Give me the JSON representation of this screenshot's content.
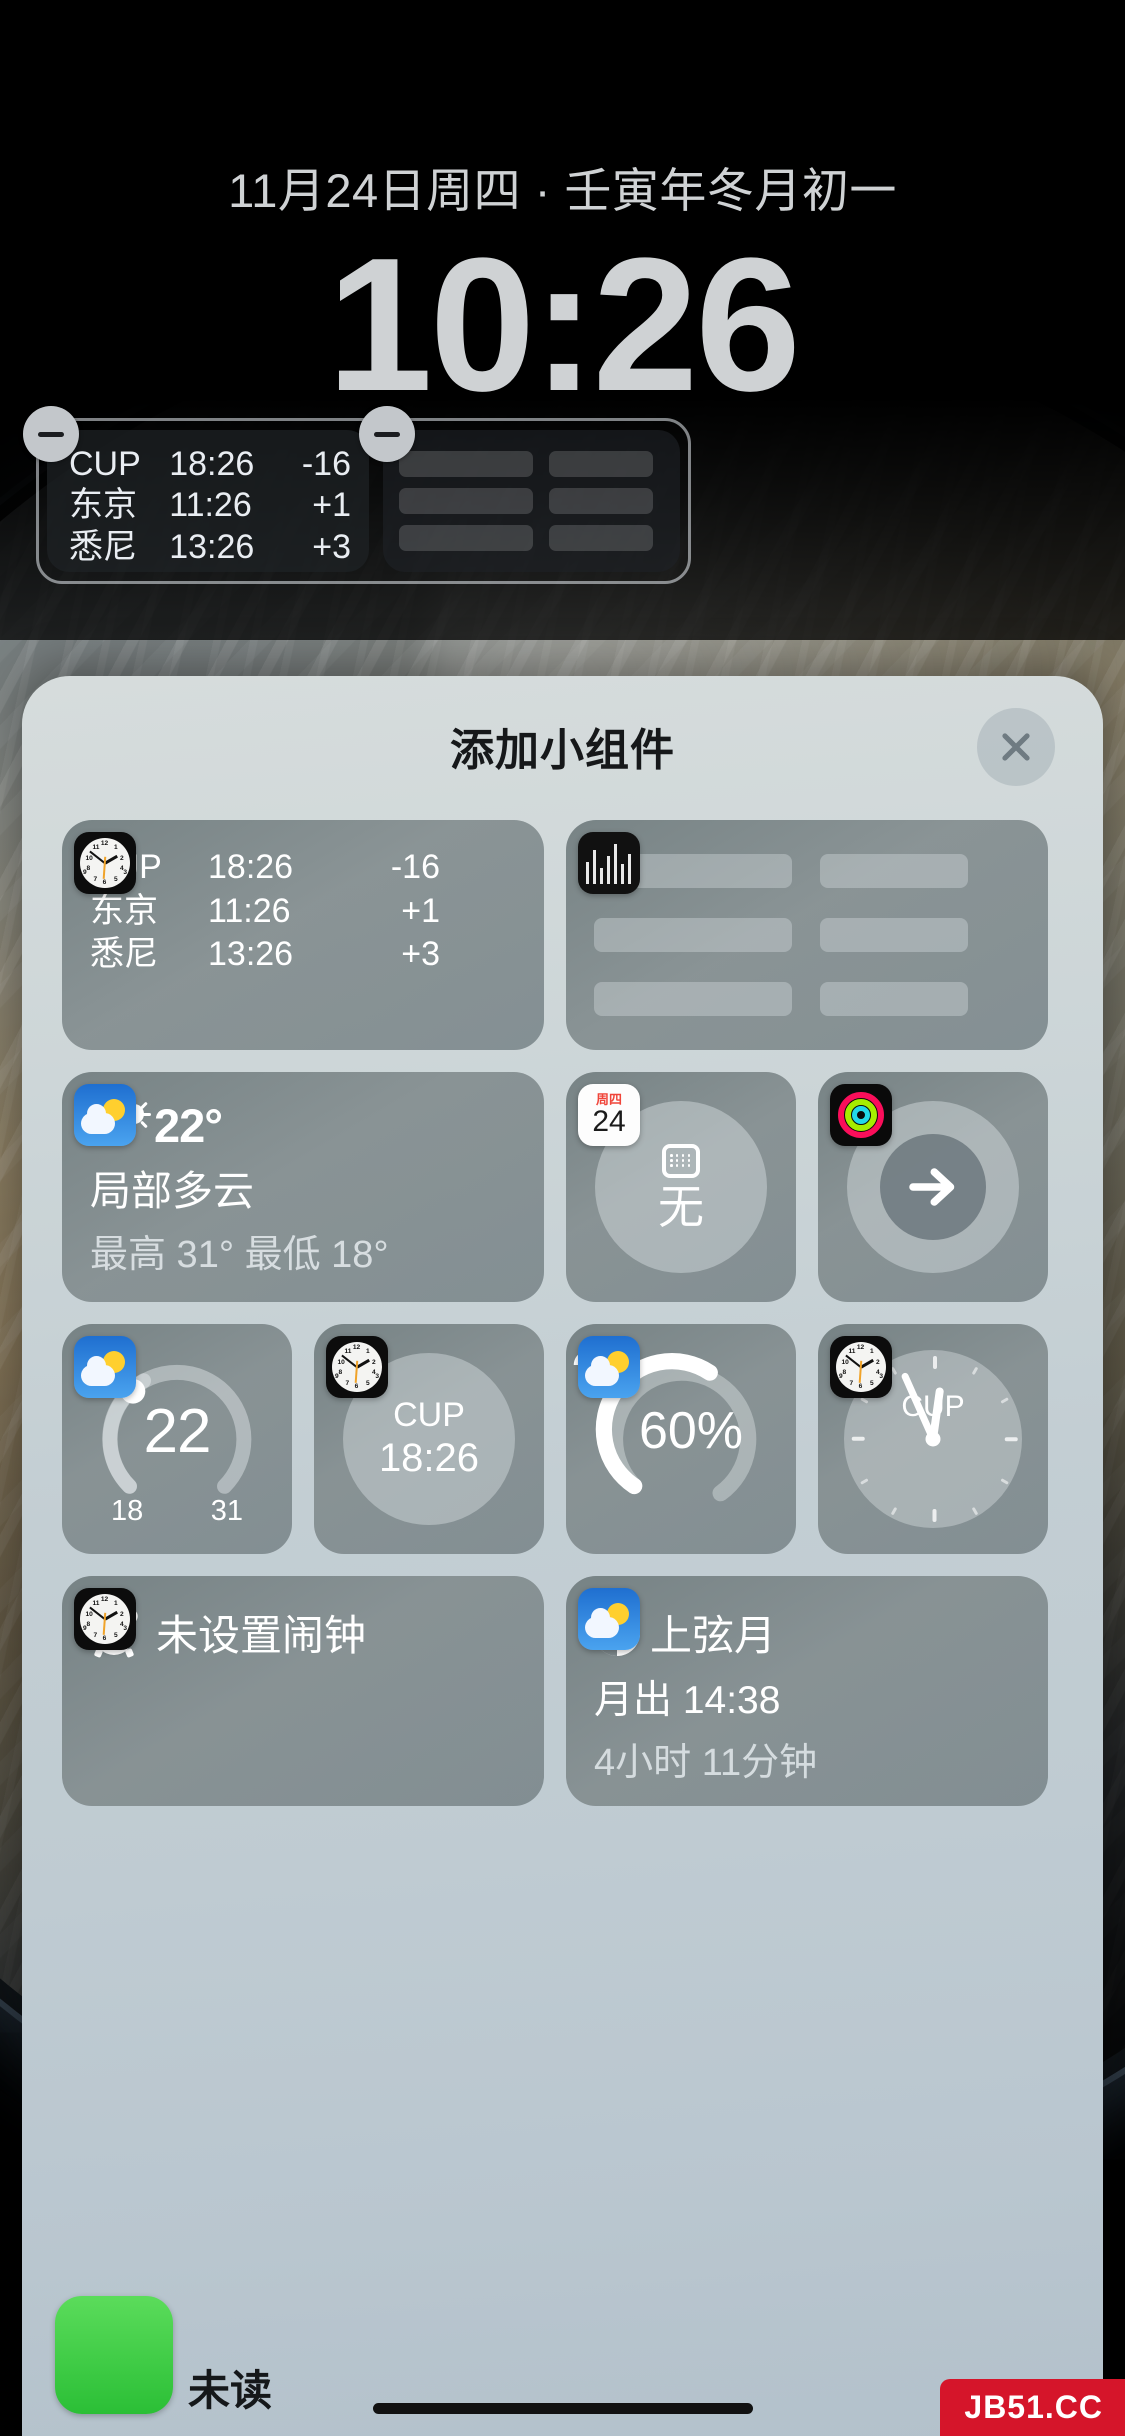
{
  "lock_screen": {
    "date": "11月24日周四 · 壬寅年冬月初一",
    "time": "10:26",
    "widgets": [
      {
        "name": "world-clock",
        "rows": [
          {
            "city": "CUP",
            "time": "18:26",
            "offset": "-16"
          },
          {
            "city": "东京",
            "time": "11:26",
            "offset": "+1"
          },
          {
            "city": "悉尼",
            "time": "13:26",
            "offset": "+3"
          }
        ]
      },
      {
        "name": "stocks-placeholder"
      }
    ]
  },
  "sheet": {
    "title": "添加小组件",
    "close_label": "×",
    "widgets": {
      "world_clock": {
        "rows": [
          {
            "city": "CUP",
            "time": "18:26",
            "offset": "-16"
          },
          {
            "city": "东京",
            "time": "11:26",
            "offset": "+1"
          },
          {
            "city": "悉尼",
            "time": "13:26",
            "offset": "+3"
          }
        ],
        "app": "clock-icon"
      },
      "stocks": {
        "app": "stocks-icon"
      },
      "weather": {
        "temperature": "22°",
        "condition": "局部多云",
        "high_low": "最高 31° 最低 18°",
        "app": "weather-icon"
      },
      "calendar": {
        "value": "无",
        "badge_dow": "周四",
        "badge_day": "24",
        "app": "calendar-icon"
      },
      "fitness": {
        "app": "fitness-icon"
      },
      "temp_gauge": {
        "value": "22",
        "low": "18",
        "high": "31",
        "app": "weather-icon"
      },
      "cup_digital": {
        "label": "CUP",
        "time": "18:26",
        "app": "clock-icon"
      },
      "precipitation": {
        "value": "60%",
        "app": "weather-icon"
      },
      "cup_analog": {
        "label": "CUP",
        "app": "clock-icon"
      },
      "alarm": {
        "text": "未设置闹钟",
        "app": "clock-icon"
      },
      "moon": {
        "phase": "上弦月",
        "moonrise": "月出 14:38",
        "duration": "4小时 11分钟",
        "app": "weather-icon"
      }
    }
  },
  "bottom": {
    "app_label": "未读",
    "watermark": "JB51.CC"
  },
  "colors": {
    "accent_red": "#f0453a",
    "sheet_bg": "#c6d0d6",
    "widget_bg": "#78868a",
    "text_primary": "#ffffff",
    "text_secondary": "#d7dde0"
  }
}
